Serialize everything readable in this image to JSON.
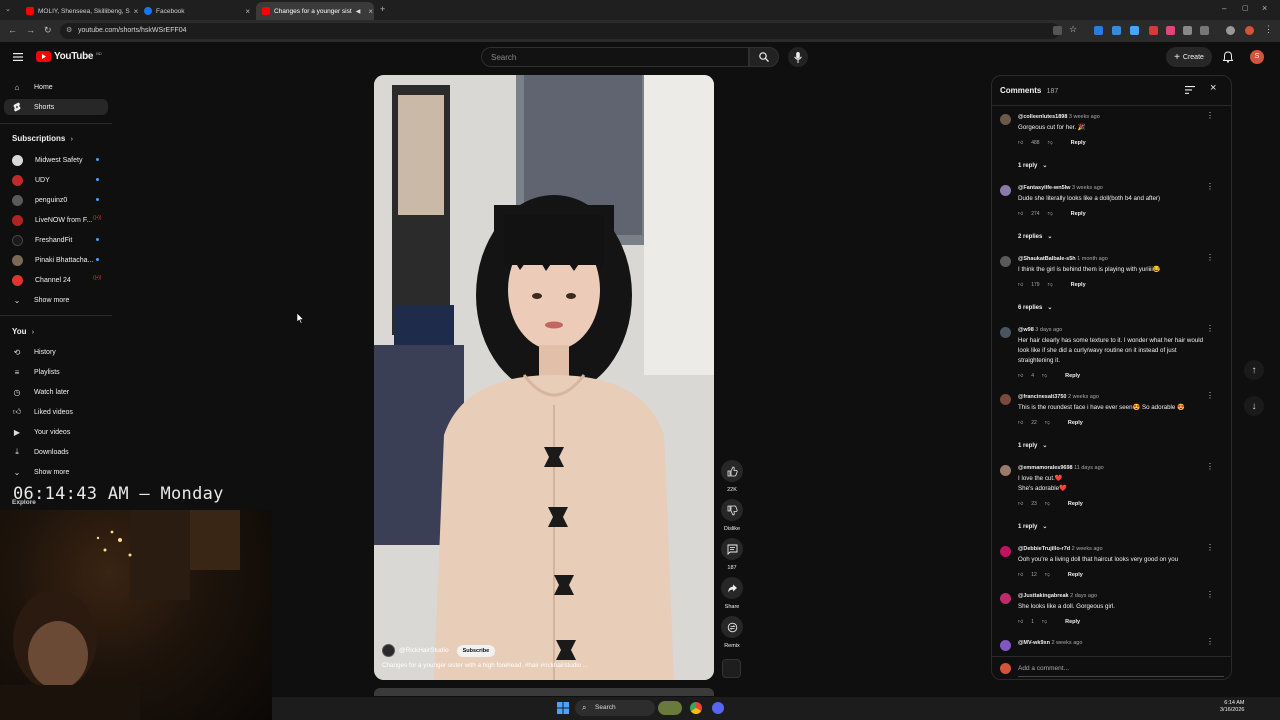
{
  "browser": {
    "tabs": [
      {
        "title": "MOLIY, Shenseea, Skillibeng, S",
        "favicon_color": "#ff0000"
      },
      {
        "title": "Facebook",
        "favicon_color": "#1877f2"
      },
      {
        "title": "Changes for a younger sist",
        "favicon_color": "#ff0000"
      }
    ],
    "url": "youtube.com/shorts/hskWSrEFF04"
  },
  "header": {
    "logo_text": "YouTube",
    "logo_sup": "BD",
    "search_placeholder": "Search",
    "create_label": "Create",
    "avatar_letter": "S"
  },
  "sidebar": {
    "primary": [
      {
        "label": "Home",
        "icon": "home-icon"
      },
      {
        "label": "Shorts",
        "icon": "shorts-icon"
      }
    ],
    "subscriptions_title": "Subscriptions",
    "subscriptions": [
      {
        "label": "Midwest Safety",
        "color": "#d9d9d9",
        "indicator": "dot"
      },
      {
        "label": "UDY",
        "color": "#c12a2a",
        "indicator": "dot"
      },
      {
        "label": "penguinz0",
        "color": "#5a5a5a",
        "indicator": "dot"
      },
      {
        "label": "LiveNOW from F...",
        "color": "#b22222",
        "indicator": "live"
      },
      {
        "label": "FreshandFit",
        "color": "#1a1a1a",
        "indicator": "dot"
      },
      {
        "label": "Pinaki Bhattacha...",
        "color": "#7a6a55",
        "indicator": "dot"
      },
      {
        "label": "Channel 24",
        "color": "#e0342e",
        "indicator": "live"
      }
    ],
    "show_more_1": "Show more",
    "you_title": "You",
    "you_items": [
      {
        "label": "History",
        "icon": "history-icon"
      },
      {
        "label": "Playlists",
        "icon": "playlists-icon"
      },
      {
        "label": "Watch later",
        "icon": "watch-later-icon"
      },
      {
        "label": "Liked videos",
        "icon": "like-icon"
      },
      {
        "label": "Your videos",
        "icon": "your-videos-icon"
      },
      {
        "label": "Downloads",
        "icon": "download-icon"
      }
    ],
    "show_more_2": "Show more",
    "explore_title": "Explore"
  },
  "overlay": {
    "clock": "06:14:43 AM – Monday"
  },
  "video": {
    "channel": "@RickHairStudio",
    "subscribe_label": "Subscribe",
    "caption": "Changes for a younger sister with a high forehead. #hair #rickhairstudio ..."
  },
  "actions": {
    "likes": "22K",
    "dislike": "Dislike",
    "comments": "187",
    "share": "Share",
    "remix": "Remix"
  },
  "comments": {
    "title": "Comments",
    "count": "187",
    "items": [
      {
        "user": "@colleenlutes1898",
        "ago": "3 weeks ago",
        "text": "Gorgeous cut for her. 🎉",
        "likes": "488",
        "replies": "1 reply",
        "color": "#6b5a4a"
      },
      {
        "user": "@Fantasylife-wn5lw",
        "ago": "3 weeks ago",
        "text": "Dude she literally looks like a doll(both b4 and after)",
        "likes": "274",
        "replies": "2 replies",
        "color": "#8a7aa8"
      },
      {
        "user": "@ShaukatBalbale-s5h",
        "ago": "1 month ago",
        "text": "I think the girl is behind them is playing with yuriiii😂",
        "likes": "179",
        "replies": "6 replies",
        "color": "#5a5a5a"
      },
      {
        "user": "@w98",
        "ago": "3 days ago",
        "text": "Her hair clearly has some texture to it. I wonder what her hair would look like if she did a curly/wavy routine on it instead of just straightening it.",
        "likes": "4",
        "replies": "",
        "color": "#4a5560"
      },
      {
        "user": "@francinesalt3750",
        "ago": "2 weeks ago",
        "text": "This is the roundest face i have ever seen😍 So adorable 😍",
        "likes": "22",
        "replies": "1 reply",
        "color": "#7a4a3a"
      },
      {
        "user": "@emmamorales9698",
        "ago": "11 days ago",
        "text": "I love the cut.❤️|She's adorable❤️",
        "likes": "23",
        "replies": "1 reply",
        "color": "#9a7a6a"
      },
      {
        "user": "@DebbieTrujillo-r7d",
        "ago": "2 weeks ago",
        "text": "Ooh you're a living doll that haircut looks very good on you",
        "likes": "12",
        "replies": "",
        "color": "#c0135f"
      },
      {
        "user": "@Justtakingabreak",
        "ago": "2 days ago",
        "text": "She looks like a doll.  Gorgeous girl.",
        "likes": "1",
        "replies": "",
        "color": "#c02a6a"
      },
      {
        "user": "@MV-wk9xn",
        "ago": "2 weeks ago",
        "text": "",
        "likes": "",
        "replies": "",
        "color": "#7e57c2"
      }
    ],
    "reply_label": "Reply",
    "add_placeholder": "Add a comment..."
  },
  "taskbar": {
    "search_label": "Search",
    "time": "6:14 AM",
    "date": "3/16/2026"
  }
}
